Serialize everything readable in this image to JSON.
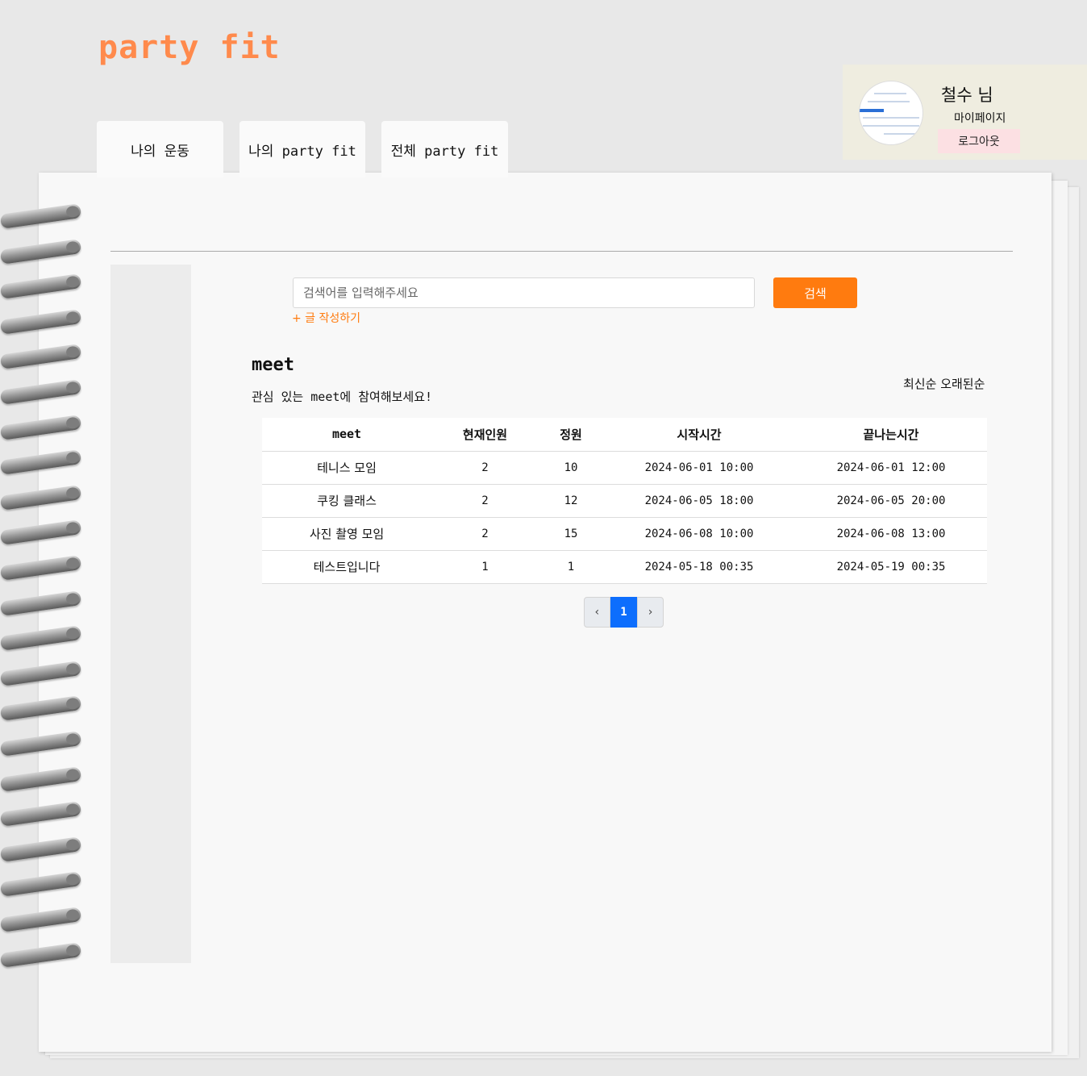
{
  "header": {
    "logo": "party fit"
  },
  "profile": {
    "user_name": "철수 님",
    "mypage_label": "마이페이지",
    "logout_label": "로그아웃"
  },
  "tabs": [
    {
      "label": "나의 운동"
    },
    {
      "label": "나의 party fit"
    },
    {
      "label": "전체 party fit"
    }
  ],
  "search": {
    "placeholder": "검색어를 입력해주세요",
    "value": "",
    "button_label": "검색",
    "write_link": "+ 글 작성하기"
  },
  "section": {
    "title": "meet",
    "subtitle": "관심 있는 meet에 참여해보세요!",
    "sort_newest": "최신순",
    "sort_oldest": "오래된순"
  },
  "table": {
    "headers": [
      "meet",
      "현재인원",
      "정원",
      "시작시간",
      "끝나는시간"
    ],
    "rows": [
      [
        "테니스 모임",
        "2",
        "10",
        "2024-06-01 10:00",
        "2024-06-01 12:00"
      ],
      [
        "쿠킹 클래스",
        "2",
        "12",
        "2024-06-05 18:00",
        "2024-06-05 20:00"
      ],
      [
        "사진 촬영 모임",
        "2",
        "15",
        "2024-06-08 10:00",
        "2024-06-08 13:00"
      ],
      [
        "테스트입니다",
        "1",
        "1",
        "2024-05-18 00:35",
        "2024-05-19 00:35"
      ]
    ]
  },
  "pagination": {
    "prev_icon": "‹",
    "current_page": "1",
    "next_icon": "›"
  },
  "colors": {
    "accent": "#ff7b0f",
    "logo": "#ff8a4c",
    "page_active": "#0d6efd",
    "logout_bg": "#fce0e3"
  }
}
